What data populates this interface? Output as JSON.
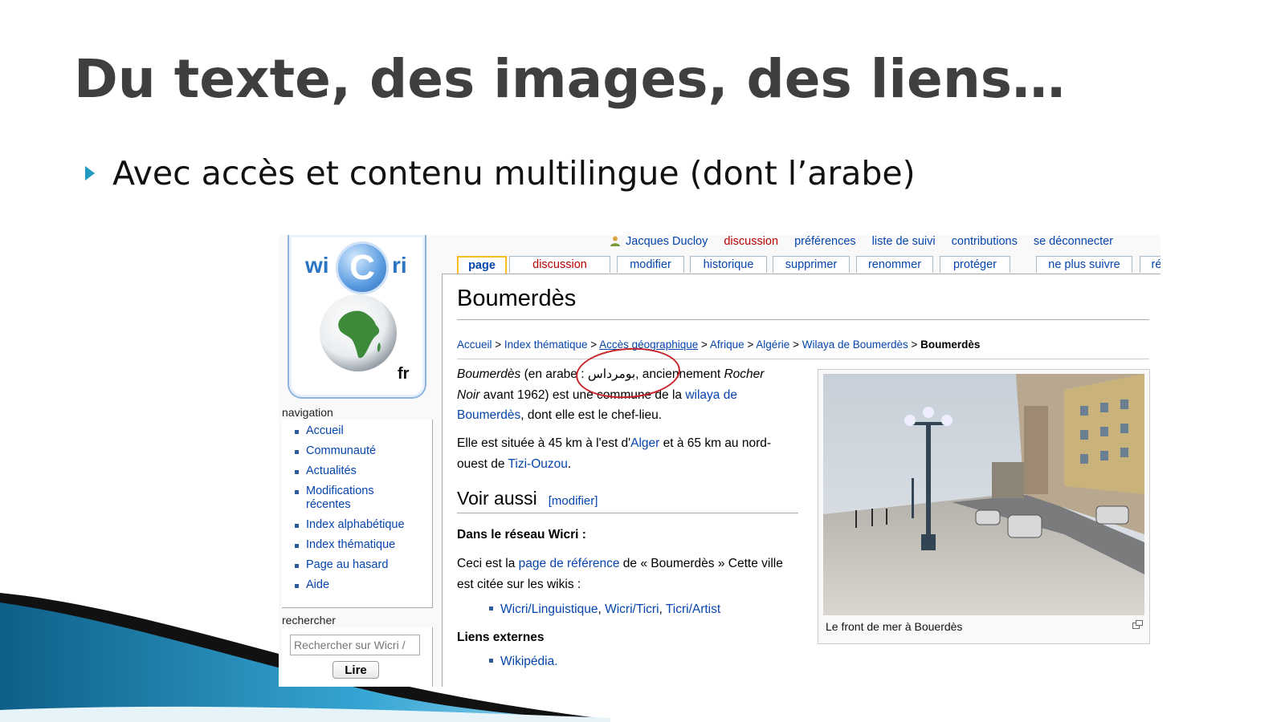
{
  "slide": {
    "title": "Du texte, des images, des liens…",
    "bullet": "Avec accès et contenu multilingue (dont l’arabe)"
  },
  "wiki": {
    "logo": {
      "left": "wi",
      "center": "C",
      "right": "ri",
      "lang": "fr",
      "icon": "africa-globe-icon"
    },
    "personal": {
      "user": "Jacques Ducloy",
      "discussion": "discussion",
      "preferences": "préférences",
      "watchlist": "liste de suivi",
      "contributions": "contributions",
      "logout": "se déconnecter"
    },
    "tabs": [
      "page",
      "discussion",
      "modifier",
      "historique",
      "supprimer",
      "renommer",
      "protéger",
      "ne plus suivre",
      "ré"
    ],
    "navigation": {
      "heading": "navigation",
      "items": [
        "Accueil",
        "Communauté",
        "Actualités",
        "Modifications récentes",
        "Index alphabétique",
        "Index thématique",
        "Page au hasard",
        "Aide"
      ]
    },
    "search": {
      "heading": "rechercher",
      "placeholder": "Rechercher sur Wicri /",
      "button": "Lire"
    },
    "article": {
      "title": "Boumerdès",
      "breadcrumb": {
        "items": [
          "Accueil",
          "Index thématique",
          "Accès géographique",
          "Afrique",
          "Algérie",
          "Wilaya de Boumerdès"
        ],
        "current": "Boumerdès",
        "sep": " > "
      },
      "p1": {
        "name": "Boumerdès",
        "t1": " (en arabe : ",
        "arabic": "بومرداس",
        "t2": ", anciennement ",
        "old_name": "Rocher Noir",
        "t3": " avant 1962) est une commune de la ",
        "link": "wilaya de Boumerdès",
        "t4": ", dont elle est le chef-lieu."
      },
      "p2": {
        "t1": "Elle est située à 45 km à l'est d'",
        "link1": "Alger",
        "t2": " et à 65 km au nord-ouest de ",
        "link2": "Tizi-Ouzou",
        "t3": "."
      },
      "see_also": {
        "heading": "Voir aussi",
        "edit": "[modifier]"
      },
      "network": {
        "heading": "Dans le réseau Wicri :",
        "t1": "Ceci est la ",
        "link": "page de référence",
        "t2": " de « Boumerdès » Cette ville est citée sur les wikis :",
        "wikis": [
          "Wicri/Linguistique",
          "Wicri/Ticri",
          "Ticri/Artist"
        ]
      },
      "external": {
        "heading": "Liens externes",
        "items": [
          "Wikipédia."
        ]
      },
      "image_caption": "Le front de mer à Bouerdès"
    }
  },
  "colors": {
    "link": "#0645ad",
    "red_link": "#ba0000",
    "title": "#3f3f3f",
    "accent": "#1f9bc6",
    "annotation": "#c8252c"
  }
}
